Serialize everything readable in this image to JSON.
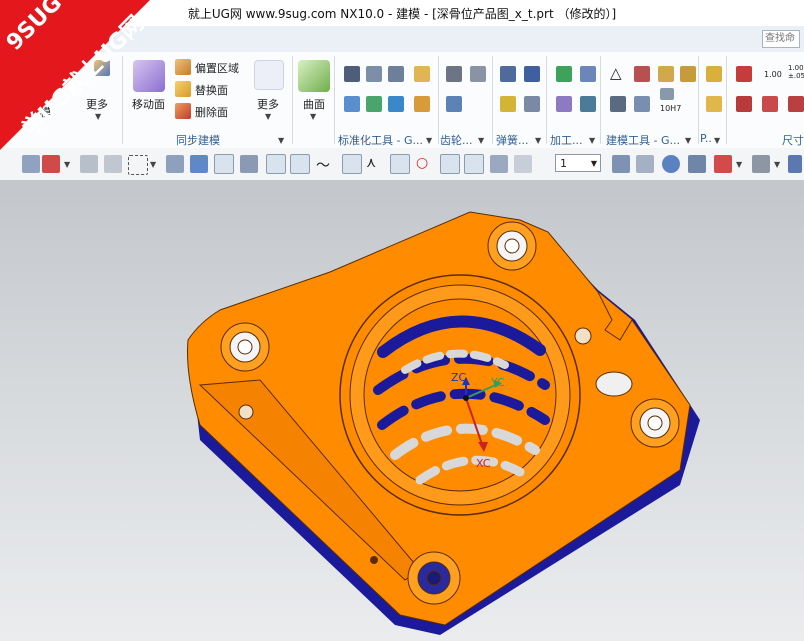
{
  "window": {
    "title": "就上UG网 www.9sug.com NX10.0 - 建模 - [深骨位产品图_x_t.prt （修改的）]"
  },
  "tabs_bar": {
    "search_placeholder": "查找命"
  },
  "ribbon": {
    "more_label_1": "更多",
    "model_label": "模",
    "move_face_label": "移动面",
    "offset_region_label": "偏置区域",
    "replace_face_label": "替换面",
    "delete_face_label": "删除面",
    "more_label_2": "更多",
    "surface_label": "曲面",
    "group_sync": "同步建模",
    "group_standard": "标准化工具 - G...",
    "group_gear": "齿轮...",
    "group_spring": "弹簧...",
    "group_machining": "加工...",
    "group_modeling_tools": "建模工具 - G...",
    "group_p": "P..",
    "group_dim": "尺寸",
    "small_text_100": "1.00",
    "small_text_100_005": "1.00\n±.05",
    "small_text_10h7": "10H7"
  },
  "toolbar": {
    "layer_value": "1"
  },
  "viewport": {
    "axis_zc": "ZC",
    "axis_yc": "YC",
    "axis_xc": "XC",
    "part_color": "#ff8c00",
    "underside_color": "#1a1a9a"
  },
  "watermark": {
    "line1": "9SUG",
    "line2": "学UG就上UG网"
  }
}
